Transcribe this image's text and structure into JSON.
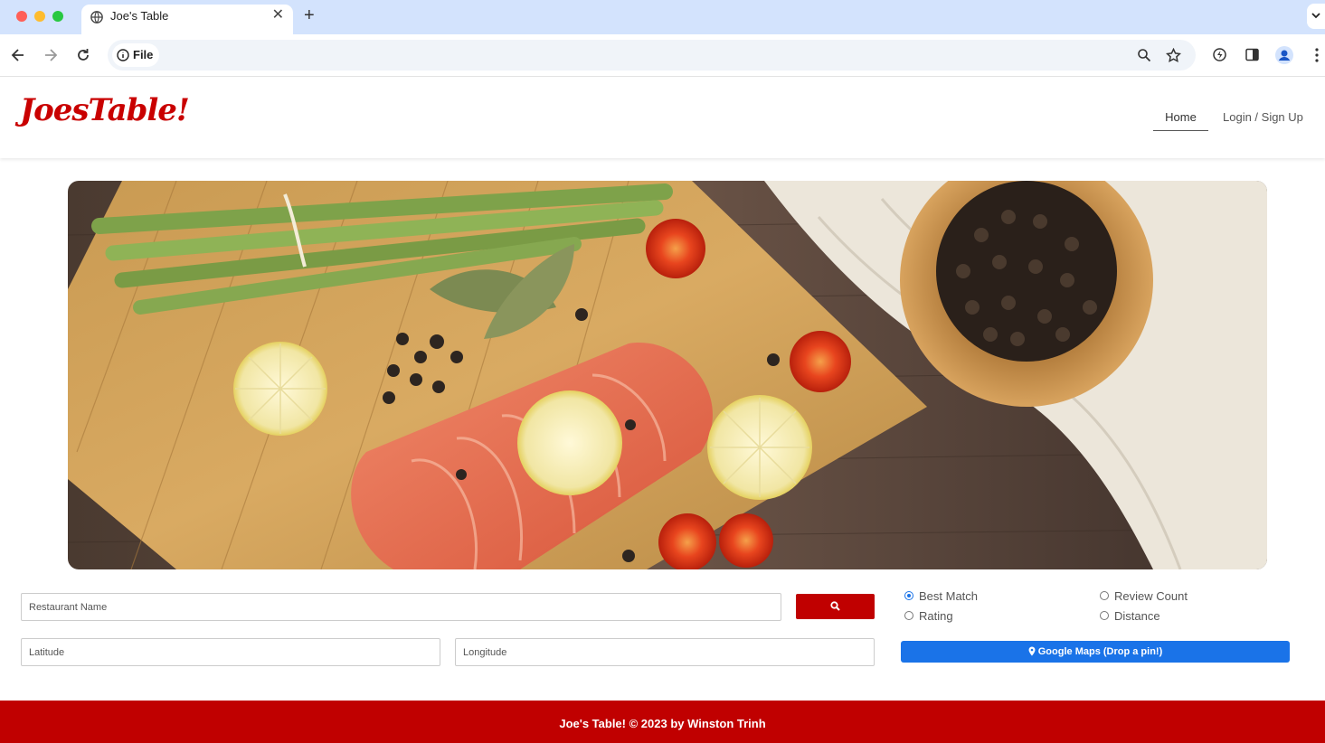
{
  "browser": {
    "tab_title": "Joe's Table",
    "address_chip": "File",
    "colors": {
      "tab_strip": "#d3e3fd",
      "omnibox": "#f0f4f9"
    }
  },
  "site": {
    "logo": "JoesTable!",
    "nav": {
      "home": "Home",
      "login": "Login / Sign Up"
    },
    "brand_color": "#c00000"
  },
  "hero": {
    "image": "overhead photo of salmon fillet with lemon slices, cherry tomatoes, asparagus, bay leaves and a bowl of peppercorns on a cutting board"
  },
  "search": {
    "restaurant_placeholder": "Restaurant Name",
    "latitude_placeholder": "Latitude",
    "longitude_placeholder": "Longitude",
    "search_icon": "search-icon",
    "sort_options": [
      {
        "label": "Best Match",
        "selected": true
      },
      {
        "label": "Review Count",
        "selected": false
      },
      {
        "label": "Rating",
        "selected": false
      },
      {
        "label": "Distance",
        "selected": false
      }
    ],
    "maps_button": "Google Maps (Drop a pin!)",
    "accent_color": "#1a73e8"
  },
  "footer": {
    "text": "Joe's Table! © 2023 by Winston Trinh"
  }
}
